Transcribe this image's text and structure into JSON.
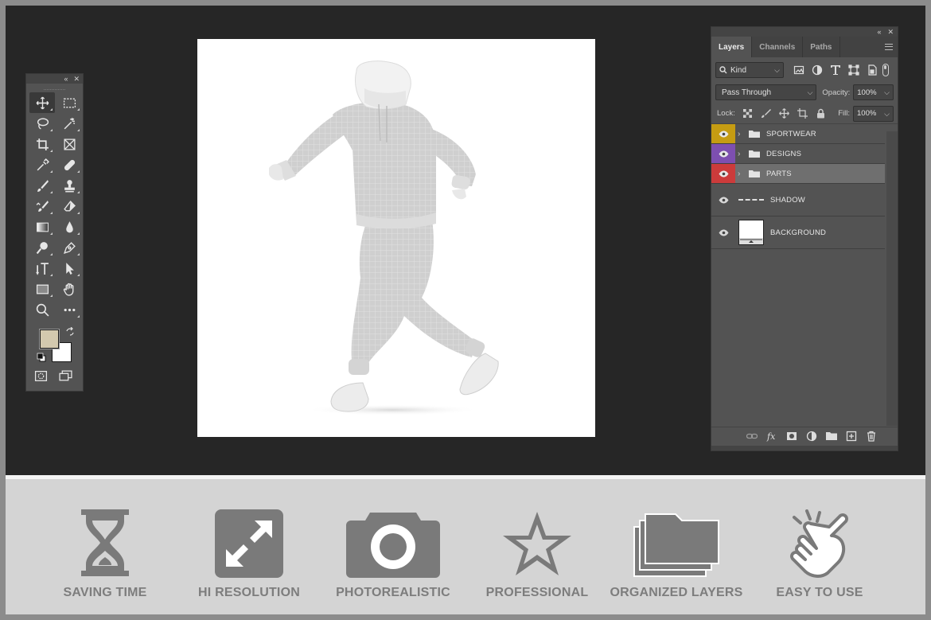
{
  "colors": {
    "foreground_swatch": "#d3c9ae",
    "background_swatch": "#ffffff",
    "sportwear_tag": "#c59c12",
    "designs_tag": "#7d4fb0",
    "parts_tag": "#cc3b3b",
    "feature_icon": "#7a7a7a"
  },
  "layers_panel": {
    "tabs": [
      {
        "label": "Layers",
        "active": true
      },
      {
        "label": "Channels",
        "active": false
      },
      {
        "label": "Paths",
        "active": false
      }
    ],
    "filter_kind": "Kind",
    "blend_mode": "Pass Through",
    "opacity_label": "Opacity:",
    "opacity_value": "100%",
    "lock_label": "Lock:",
    "fill_label": "Fill:",
    "fill_value": "100%",
    "layers": [
      {
        "name": "SPORTWEAR",
        "type": "group",
        "tag_color": "#c59c12"
      },
      {
        "name": "DESIGNS",
        "type": "group",
        "tag_color": "#7d4fb0"
      },
      {
        "name": "PARTS",
        "type": "group",
        "tag_color": "#cc3b3b",
        "selected": true
      },
      {
        "name": "SHADOW",
        "type": "layer"
      },
      {
        "name": "BACKGROUND",
        "type": "layer"
      }
    ]
  },
  "toolbox": {
    "tools": [
      "move-tool-icon",
      "marquee-tool-icon",
      "lasso-tool-icon",
      "magic-wand-icon",
      "crop-tool-icon",
      "frame-tool-icon",
      "eyedropper-icon",
      "healing-brush-icon",
      "brush-tool-icon",
      "clone-stamp-icon",
      "history-brush-icon",
      "eraser-icon",
      "gradient-tool-icon",
      "blur-tool-icon",
      "dodge-tool-icon",
      "pen-tool-icon",
      "type-tool-icon",
      "path-selection-icon",
      "rectangle-tool-icon",
      "hand-tool-icon",
      "zoom-tool-icon",
      "more-tools-icon"
    ]
  },
  "features": [
    {
      "label": "SAVING TIME",
      "icon": "hourglass-icon"
    },
    {
      "label": "HI RESOLUTION",
      "icon": "expand-icon"
    },
    {
      "label": "PHOTOREALISTIC",
      "icon": "camera-icon"
    },
    {
      "label": "PROFESSIONAL",
      "icon": "star-icon"
    },
    {
      "label": "ORGANIZED LAYERS",
      "icon": "stacked-folders-icon"
    },
    {
      "label": "EASY TO USE",
      "icon": "tap-hand-icon"
    }
  ]
}
